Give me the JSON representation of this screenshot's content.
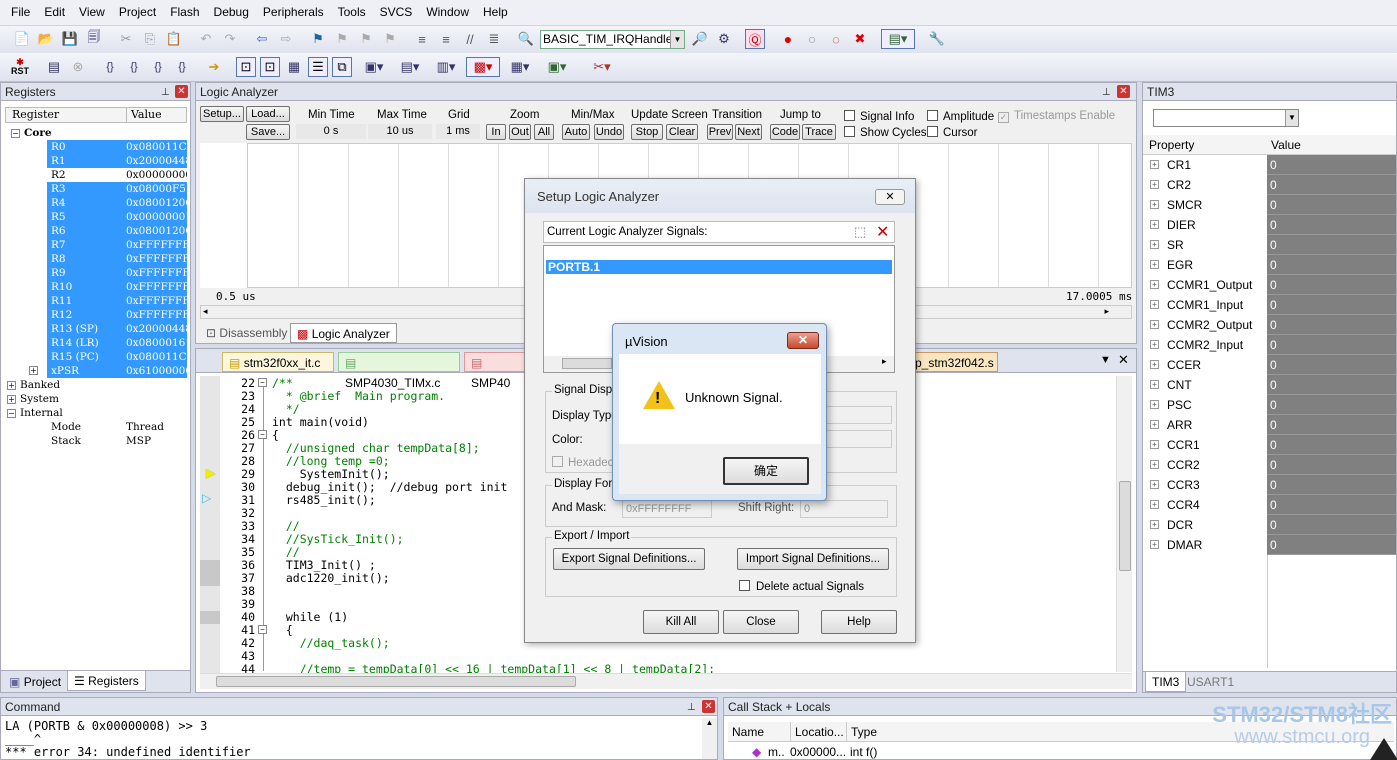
{
  "menu": [
    "File",
    "Edit",
    "View",
    "Project",
    "Flash",
    "Debug",
    "Peripherals",
    "Tools",
    "SVCS",
    "Window",
    "Help"
  ],
  "toolbar": {
    "function_combo": "BASIC_TIM_IRQHandler",
    "rst_label": "RST"
  },
  "registers_panel": {
    "title": "Registers",
    "col_register": "Register",
    "col_value": "Value",
    "core_label": "Core",
    "rows": [
      {
        "name": "R0",
        "value": "0x080011CD",
        "selected": true
      },
      {
        "name": "R1",
        "value": "0x20000448",
        "selected": true
      },
      {
        "name": "R2",
        "value": "0x00000000",
        "selected": false
      },
      {
        "name": "R3",
        "value": "0x08000F51",
        "selected": true
      },
      {
        "name": "R4",
        "value": "0x0800120C",
        "selected": true
      },
      {
        "name": "R5",
        "value": "0x00000001",
        "selected": true
      },
      {
        "name": "R6",
        "value": "0x0800120C",
        "selected": true
      },
      {
        "name": "R7",
        "value": "0xFFFFFFFF",
        "selected": true
      },
      {
        "name": "R8",
        "value": "0xFFFFFFFF",
        "selected": true
      },
      {
        "name": "R9",
        "value": "0xFFFFFFFF",
        "selected": true
      },
      {
        "name": "R10",
        "value": "0xFFFFFFFF",
        "selected": true
      },
      {
        "name": "R11",
        "value": "0xFFFFFFFF",
        "selected": true
      },
      {
        "name": "R12",
        "value": "0xFFFFFFFF",
        "selected": true
      },
      {
        "name": "R13 (SP)",
        "value": "0x20000448",
        "selected": true
      },
      {
        "name": "R14 (LR)",
        "value": "0x08000161",
        "selected": true
      },
      {
        "name": "R15 (PC)",
        "value": "0x080011CC",
        "selected": true
      },
      {
        "name": "xPSR",
        "value": "0x61000000",
        "selected": true
      }
    ],
    "banked": "Banked",
    "system": "System",
    "internal": "Internal",
    "mode_label": "Mode",
    "mode_value": "Thread",
    "stack_label": "Stack",
    "stack_value": "MSP",
    "tab_project": "Project",
    "tab_registers": "Registers"
  },
  "logic_analyzer": {
    "title": "Logic Analyzer",
    "setup": "Setup...",
    "load": "Load...",
    "save": "Save...",
    "min_time_label": "Min Time",
    "min_time": "0 s",
    "max_time_label": "Max Time",
    "max_time": "10 us",
    "grid_label": "Grid",
    "grid": "1 ms",
    "zoom_label": "Zoom",
    "zoom_in": "In",
    "zoom_out": "Out",
    "zoom_all": "All",
    "minmax_label": "Min/Max",
    "auto": "Auto",
    "undo": "Undo",
    "update_label": "Update Screen",
    "stop": "Stop",
    "clear": "Clear",
    "transition_label": "Transition",
    "prev": "Prev",
    "next": "Next",
    "jump_label": "Jump to",
    "code": "Code",
    "trace": "Trace",
    "signal_info": "Signal Info",
    "show_cycles": "Show Cycles",
    "amplitude": "Amplitude",
    "cursor": "Cursor",
    "timestamps": "Timestamps Enable",
    "left_time": "0.5 us",
    "right_time": "17.0005 ms",
    "tab_disassembly": "Disassembly",
    "tab_la": "Logic Analyzer"
  },
  "editor": {
    "tabs": [
      "stm32f0xx_it.c",
      "SMP4030_TIMx.c",
      "SMP40",
      "p_stm32f042.s"
    ],
    "lines": [
      {
        "n": "22",
        "t": "/**",
        "c": "cm"
      },
      {
        "n": "23",
        "t": "  * @brief  Main program.",
        "c": "cm"
      },
      {
        "n": "24",
        "t": "  */",
        "c": "cm"
      },
      {
        "n": "25",
        "t": "int main(void)",
        "c": ""
      },
      {
        "n": "26",
        "t": "{",
        "c": ""
      },
      {
        "n": "27",
        "t": "  //unsigned char tempData[8];",
        "c": "cm"
      },
      {
        "n": "28",
        "t": "  //long temp =0;",
        "c": "cm"
      },
      {
        "n": "29",
        "t": "    SystemInit();",
        "c": ""
      },
      {
        "n": "30",
        "t": "  debug_init();  //debug port init",
        "c": ""
      },
      {
        "n": "31",
        "t": "  rs485_init();",
        "c": ""
      },
      {
        "n": "32",
        "t": "",
        "c": ""
      },
      {
        "n": "33",
        "t": "  //",
        "c": "cm"
      },
      {
        "n": "34",
        "t": "  //SysTick_Init();",
        "c": "cm"
      },
      {
        "n": "35",
        "t": "  //",
        "c": "cm"
      },
      {
        "n": "36",
        "t": "  TIM3_Init() ;",
        "c": ""
      },
      {
        "n": "37",
        "t": "  adc1220_init();",
        "c": ""
      },
      {
        "n": "38",
        "t": "",
        "c": ""
      },
      {
        "n": "39",
        "t": "",
        "c": ""
      },
      {
        "n": "40",
        "t": "  while (1)",
        "c": ""
      },
      {
        "n": "41",
        "t": "  {",
        "c": ""
      },
      {
        "n": "42",
        "t": "    //daq_task();",
        "c": "cm"
      },
      {
        "n": "43",
        "t": "",
        "c": ""
      },
      {
        "n": "44",
        "t": "    //temp = tempData[0] << 16 | tempData[1] << 8 | tempData[2];",
        "c": "cm"
      }
    ]
  },
  "tim3_panel": {
    "title": "TIM3",
    "col_property": "Property",
    "col_value": "Value",
    "props": [
      {
        "name": "CR1",
        "value": "0"
      },
      {
        "name": "CR2",
        "value": "0"
      },
      {
        "name": "SMCR",
        "value": "0"
      },
      {
        "name": "DIER",
        "value": "0"
      },
      {
        "name": "SR",
        "value": "0"
      },
      {
        "name": "EGR",
        "value": "0"
      },
      {
        "name": "CCMR1_Output",
        "value": "0"
      },
      {
        "name": "CCMR1_Input",
        "value": "0"
      },
      {
        "name": "CCMR2_Output",
        "value": "0"
      },
      {
        "name": "CCMR2_Input",
        "value": "0"
      },
      {
        "name": "CCER",
        "value": "0"
      },
      {
        "name": "CNT",
        "value": "0"
      },
      {
        "name": "PSC",
        "value": "0"
      },
      {
        "name": "ARR",
        "value": "0"
      },
      {
        "name": "CCR1",
        "value": "0"
      },
      {
        "name": "CCR2",
        "value": "0"
      },
      {
        "name": "CCR3",
        "value": "0"
      },
      {
        "name": "CCR4",
        "value": "0"
      },
      {
        "name": "DCR",
        "value": "0"
      },
      {
        "name": "DMAR",
        "value": "0"
      }
    ],
    "tab_tim3": "TIM3",
    "tab_usart1": "USART1"
  },
  "setup_dialog": {
    "title": "Setup Logic Analyzer",
    "current_signals": "Current Logic Analyzer Signals:",
    "signal_item": "PORTB.1",
    "signal_display": "Signal Displa",
    "display_type": "Display Type",
    "color": "Color:",
    "hexadec": "Hexadec",
    "display_formula": "Display Form",
    "and_mask": "And Mask:",
    "and_mask_value": "0xFFFFFFFF",
    "shift_right": "Shift Right:",
    "shift_value": "0",
    "export_import": "Export / Import",
    "export_btn": "Export Signal Definitions...",
    "import_btn": "Import Signal Definitions...",
    "delete_actual": "Delete actual Signals",
    "kill_all": "Kill All",
    "close": "Close",
    "help": "Help"
  },
  "alert_dialog": {
    "title": "µVision",
    "message": "Unknown Signal.",
    "ok": "确定"
  },
  "command_panel": {
    "title": "Command",
    "line1": "LA (PORTB & 0x00000008) >> 3",
    "line2": "____^",
    "line3": "*** error 34: undefined identifier"
  },
  "callstack_panel": {
    "title": "Call Stack + Locals",
    "col_name": "Name",
    "col_location": "Locatio...",
    "col_type": "Type",
    "row_name": "m..",
    "row_location": "0x00000...",
    "row_type": "int f()"
  },
  "watermark": {
    "line1": "STM32/STM8社区",
    "line2": "www.stmcu.org"
  }
}
